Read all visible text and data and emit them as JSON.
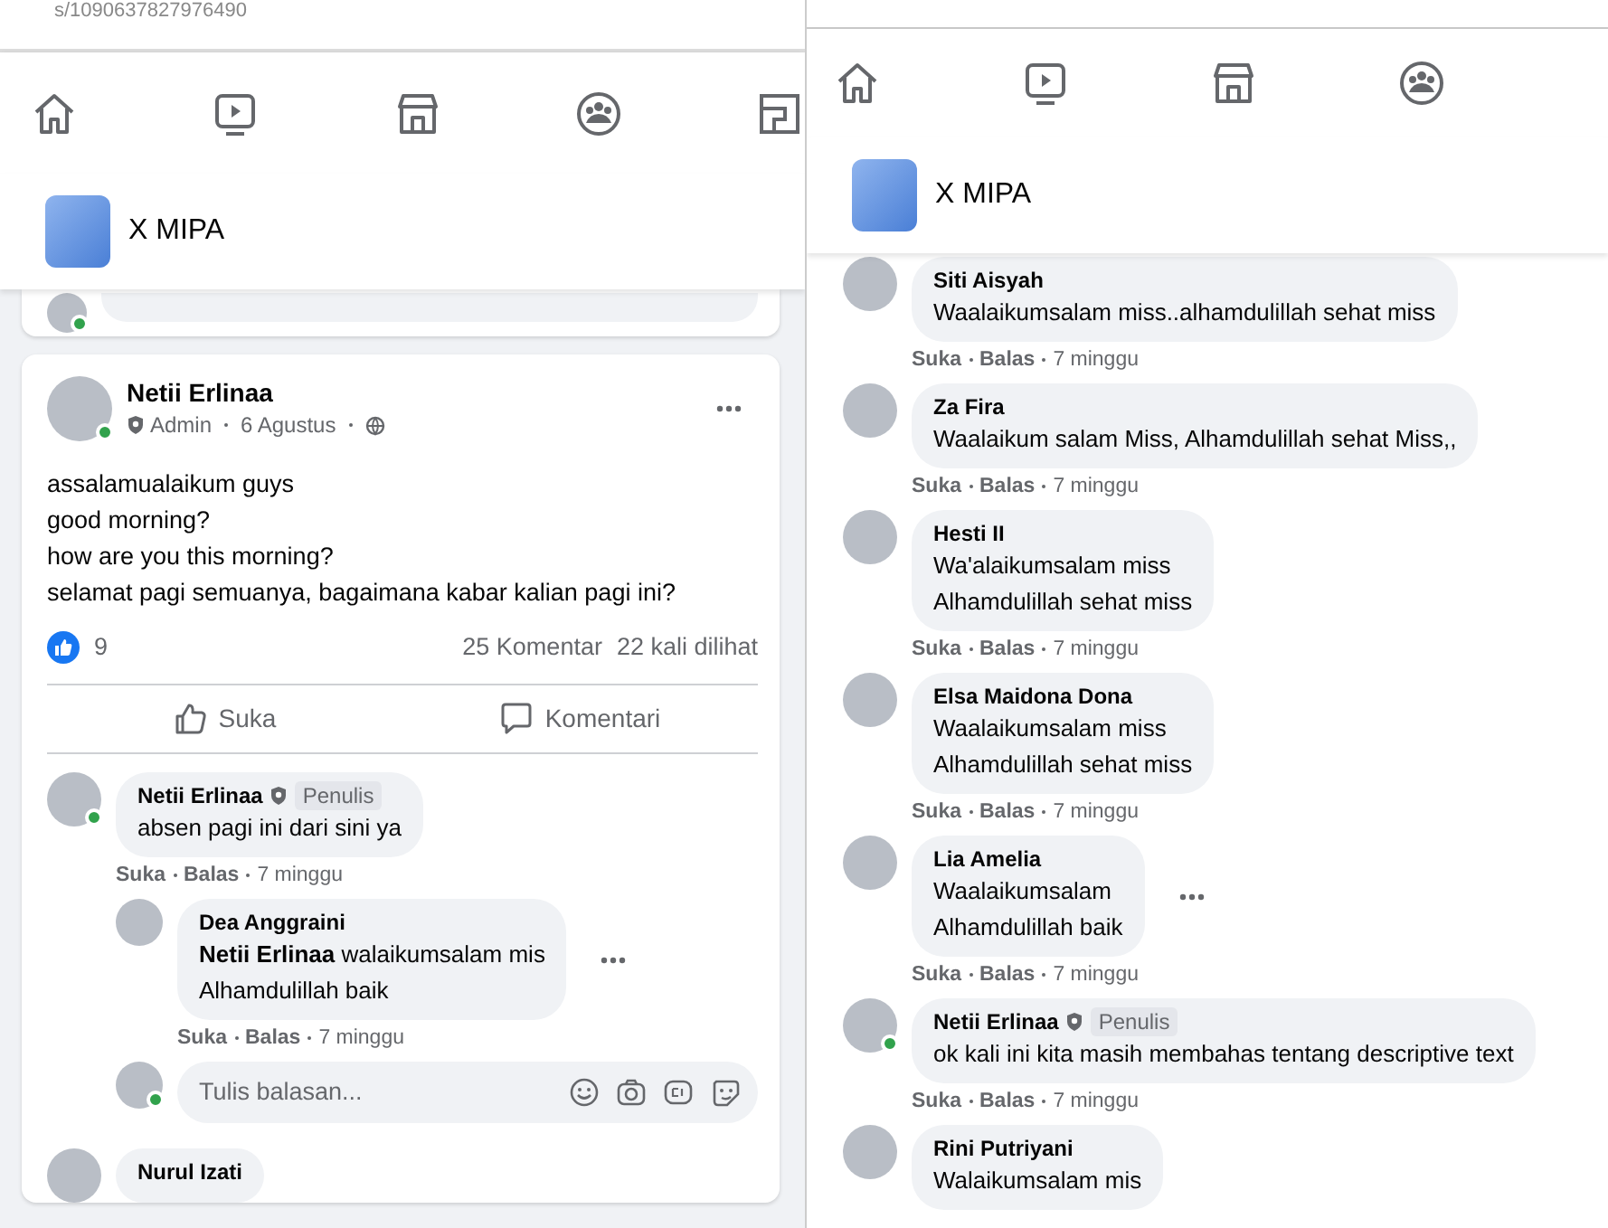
{
  "left_panel": {
    "address_fragment": "s/1090637827976490",
    "nav_tabs": [
      {
        "kind": "home"
      },
      {
        "kind": "video"
      },
      {
        "kind": "store"
      },
      {
        "kind": "groups"
      },
      {
        "kind": "pages"
      }
    ],
    "group_name": "X MIPA",
    "previous_post": {
      "online": true
    },
    "post": {
      "author": "Netii Erlinaa",
      "online": true,
      "role": "Admin",
      "date": "6 Agustus",
      "lines": [
        "assalamualaikum guys",
        "good morning?",
        "how are you this morning?",
        "selamat pagi semuanya, bagaimana kabar kalian pagi ini?"
      ],
      "reaction_count": "9",
      "comment_count": "25 Komentar",
      "view_count": "22 kali dilihat",
      "actions": [
        {
          "kind": "like",
          "label": "Suka"
        },
        {
          "kind": "comment",
          "label": "Komentari"
        }
      ],
      "comments": [
        {
          "author": "Netii Erlinaa",
          "badge": "Penulis",
          "online": true,
          "menu": false,
          "lines": [
            "absen pagi ini dari sini ya"
          ],
          "like": "Suka",
          "reply": "Balas",
          "time": "7 minggu",
          "replies": [
            {
              "author": "Dea Anggraini",
              "online": false,
              "menu": true,
              "lines": [
                "**Netii Erlinaa** walaikumsalam mis",
                "Alhamdulillah baik"
              ],
              "like": "Suka",
              "reply": "Balas",
              "time": "7 minggu"
            }
          ],
          "reply_box": {
            "placeholder": "Tulis balasan...",
            "online": true
          }
        },
        {
          "author": "Nurul Izati",
          "online": false,
          "menu": false
        }
      ]
    }
  },
  "right_panel": {
    "nav_tabs": [
      {
        "kind": "home"
      },
      {
        "kind": "video"
      },
      {
        "kind": "store"
      },
      {
        "kind": "groups"
      }
    ],
    "group_name": "X MIPA",
    "comments": [
      {
        "author": "Siti Aisyah",
        "online": false,
        "menu": false,
        "lines": [
          "Waalaikumsalam miss..alhamdulillah sehat miss"
        ],
        "like": "Suka",
        "reply": "Balas",
        "time": "7 minggu"
      },
      {
        "author": "Za Fira",
        "online": false,
        "menu": false,
        "lines": [
          "Waalaikum salam Miss, Alhamdulillah sehat Miss,,"
        ],
        "like": "Suka",
        "reply": "Balas",
        "time": "7 minggu"
      },
      {
        "author": "Hesti II",
        "online": false,
        "menu": false,
        "lines": [
          "Wa'alaikumsalam miss",
          "Alhamdulillah sehat miss"
        ],
        "like": "Suka",
        "reply": "Balas",
        "time": "7 minggu"
      },
      {
        "author": "Elsa Maidona Dona",
        "online": false,
        "menu": false,
        "lines": [
          "Waalaikumsalam miss",
          "Alhamdulillah sehat miss"
        ],
        "like": "Suka",
        "reply": "Balas",
        "time": "7 minggu"
      },
      {
        "author": "Lia Amelia",
        "online": false,
        "menu": true,
        "lines": [
          "Waalaikumsalam",
          "Alhamdulillah baik"
        ],
        "like": "Suka",
        "reply": "Balas",
        "time": "7 minggu"
      },
      {
        "author": "Netii Erlinaa",
        "badge": "Penulis",
        "online": true,
        "menu": false,
        "lines": [
          "ok kali ini kita masih membahas tentang descriptive text"
        ],
        "like": "Suka",
        "reply": "Balas",
        "time": "7 minggu"
      },
      {
        "author": "Rini Putriyani",
        "online": false,
        "menu": false,
        "lines": [
          "Walaikumsalam mis"
        ]
      }
    ]
  }
}
